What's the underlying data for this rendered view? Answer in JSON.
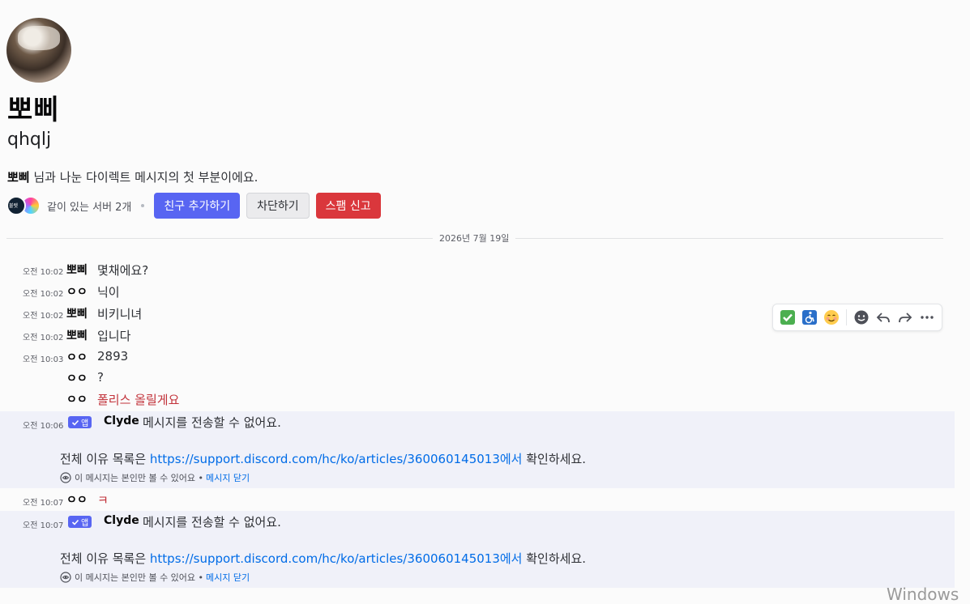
{
  "profile": {
    "display_name": "뽀삐",
    "username": "qhqlj",
    "intro_name": "뽀삐",
    "intro_rest": " 님과 나눈 다이렉트 메시지의 첫 부분이에요.",
    "mutual_servers": "같이 있는 서버 2개",
    "mutual_avatar_1_text": "불렛",
    "buttons": {
      "add_friend": "친구 추가하기",
      "block": "차단하기",
      "report_spam": "스팸 신고"
    }
  },
  "date_divider": "2026년 7월 19일",
  "messages": [
    {
      "time": "오전 10:02",
      "author": "뽀삐",
      "text": "몇채에요?"
    },
    {
      "time": "오전 10:02",
      "author": "ㅇㅇ",
      "text": "닉이"
    },
    {
      "time": "오전 10:02",
      "author": "뽀삐",
      "text": "비키니녀"
    },
    {
      "time": "오전 10:02",
      "author": "뽀삐",
      "text": "입니다"
    },
    {
      "time": "오전 10:03",
      "author": "ㅇㅇ",
      "text": "2893"
    },
    {
      "time": "",
      "author": "ㅇㅇ",
      "text": "?"
    },
    {
      "time": "",
      "author": "ㅇㅇ",
      "text": "폴리스 올릴게요"
    }
  ],
  "system_messages": [
    {
      "time": "오전 10:06",
      "badge": "앱",
      "author": "Clyde",
      "text": "메시지를 전송할 수 없어요.",
      "reason_prefix": "전체 이유 목록은 ",
      "reason_link": "https://support.discord.com/hc/ko/articles/360060145013에서",
      "reason_suffix": " 확인하세요.",
      "ephemeral_note": "이 메시지는 본인만 볼 수 있어요 •",
      "dismiss": "메시지 닫기"
    },
    {
      "time": "오전 10:07",
      "badge": "앱",
      "author": "Clyde",
      "text": "메시지를 전송할 수 없어요.",
      "reason_prefix": "전체 이유 목록은 ",
      "reason_link": "https://support.discord.com/hc/ko/articles/360060145013에서",
      "reason_suffix": " 확인하세요.",
      "ephemeral_note": "이 메시지는 본인만 볼 수 있어요 •",
      "dismiss": "메시지 닫기"
    }
  ],
  "between_message": {
    "time": "오전 10:07",
    "author": "ㅇㅇ",
    "text": "ㅋ"
  },
  "toolbar_icons": [
    "check-mark-emoji-icon",
    "wheelchair-emoji-icon",
    "smiling-face-emoji-icon",
    "add-reaction-icon",
    "reply-icon",
    "forward-icon",
    "more-icon"
  ],
  "watermark": "Windows 정",
  "colors": {
    "brand": "#5865f2",
    "danger": "#da373c",
    "link": "#006ce7"
  }
}
